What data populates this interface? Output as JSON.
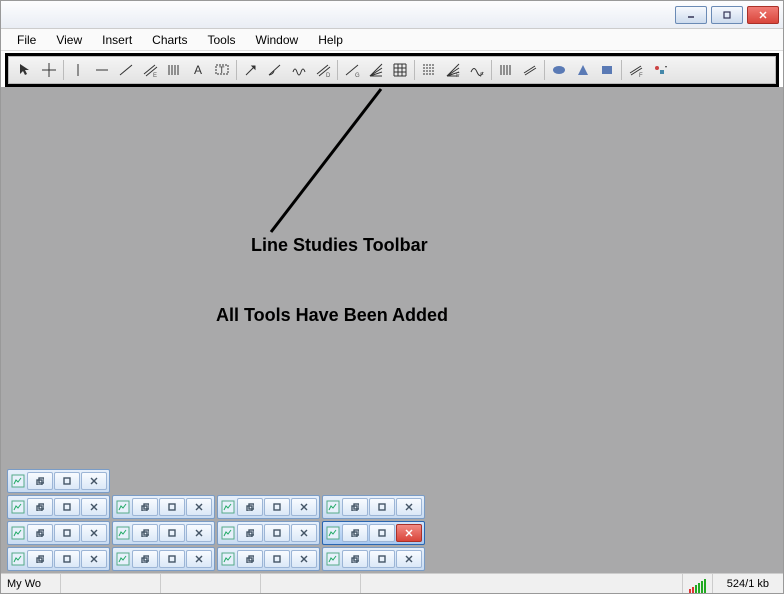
{
  "menus": [
    "File",
    "View",
    "Insert",
    "Charts",
    "Tools",
    "Window",
    "Help"
  ],
  "toolbar_tools": [
    "cursor",
    "crosshair",
    "sep",
    "vertical-line",
    "horizontal-line",
    "trendline",
    "equidistant-channel",
    "linear-regression",
    "text-label",
    "text-annotation",
    "sep",
    "arrow",
    "trendline-by-angle",
    "cycle-lines",
    "fibonacci-channel",
    "sep",
    "gann-line",
    "gann-fan",
    "gann-grid",
    "sep",
    "fibo-group-1",
    "fibo-fan",
    "fibo-expansion",
    "sep",
    "regression-channel",
    "stddev-channel",
    "sep",
    "ellipse",
    "triangle",
    "rectangle",
    "sep",
    "andrews-pitchfork",
    "shapes-dropdown"
  ],
  "annotations": {
    "line1": "Line Studies Toolbar",
    "line2": "All Tools Have Been Added"
  },
  "mdi_layout": [
    {
      "count": 1,
      "active_close": null
    },
    {
      "count": 4,
      "active_close": null
    },
    {
      "count": 4,
      "active_close": 3
    },
    {
      "count": 4,
      "active_close": null
    }
  ],
  "status": {
    "left": "My Wo",
    "traffic": "524/1 kb"
  },
  "colors": {
    "close_red": "#d9453b",
    "mdi_blue": "#c9dcf2",
    "workspace": "#a9a9aa"
  }
}
